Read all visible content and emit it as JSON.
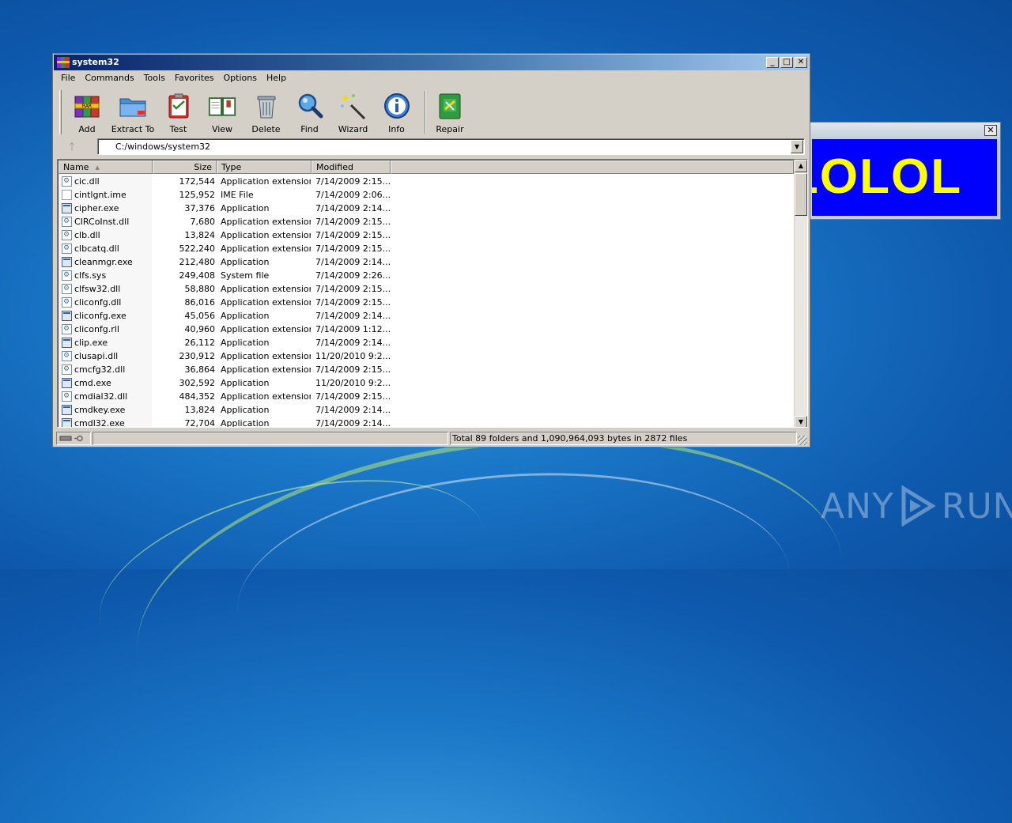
{
  "window": {
    "title": "system32"
  },
  "menu": [
    "File",
    "Commands",
    "Tools",
    "Favorites",
    "Options",
    "Help"
  ],
  "toolbar": [
    {
      "label": "Add",
      "icon": "add-archive-icon"
    },
    {
      "label": "Extract To",
      "icon": "extract-folder-icon"
    },
    {
      "label": "Test",
      "icon": "test-clipboard-icon"
    },
    {
      "label": "View",
      "icon": "view-book-icon"
    },
    {
      "label": "Delete",
      "icon": "trash-can-icon"
    },
    {
      "label": "Find",
      "icon": "magnifier-icon"
    },
    {
      "label": "Wizard",
      "icon": "magic-wand-icon"
    },
    {
      "label": "Info",
      "icon": "info-icon"
    },
    {
      "label": "Repair",
      "icon": "repair-kit-icon"
    }
  ],
  "address": {
    "path": "C:/windows/system32"
  },
  "columns": {
    "name": "Name",
    "size": "Size",
    "type": "Type",
    "modified": "Modified"
  },
  "files": [
    {
      "name": "cic.dll",
      "size": "172,544",
      "type": "Application extension",
      "modified": "7/14/2009 2:15...",
      "icon": "dll"
    },
    {
      "name": "cintlgnt.ime",
      "size": "125,952",
      "type": "IME File",
      "modified": "7/14/2009 2:06...",
      "icon": "file"
    },
    {
      "name": "cipher.exe",
      "size": "37,376",
      "type": "Application",
      "modified": "7/14/2009 2:14...",
      "icon": "exe"
    },
    {
      "name": "CIRCoInst.dll",
      "size": "7,680",
      "type": "Application extension",
      "modified": "7/14/2009 2:15...",
      "icon": "dll"
    },
    {
      "name": "clb.dll",
      "size": "13,824",
      "type": "Application extension",
      "modified": "7/14/2009 2:15...",
      "icon": "dll"
    },
    {
      "name": "clbcatq.dll",
      "size": "522,240",
      "type": "Application extension",
      "modified": "7/14/2009 2:15...",
      "icon": "dll"
    },
    {
      "name": "cleanmgr.exe",
      "size": "212,480",
      "type": "Application",
      "modified": "7/14/2009 2:14...",
      "icon": "exe"
    },
    {
      "name": "clfs.sys",
      "size": "249,408",
      "type": "System file",
      "modified": "7/14/2009 2:26...",
      "icon": "dll"
    },
    {
      "name": "clfsw32.dll",
      "size": "58,880",
      "type": "Application extension",
      "modified": "7/14/2009 2:15...",
      "icon": "dll"
    },
    {
      "name": "cliconfg.dll",
      "size": "86,016",
      "type": "Application extension",
      "modified": "7/14/2009 2:15...",
      "icon": "dll"
    },
    {
      "name": "cliconfg.exe",
      "size": "45,056",
      "type": "Application",
      "modified": "7/14/2009 2:14...",
      "icon": "exe"
    },
    {
      "name": "cliconfg.rll",
      "size": "40,960",
      "type": "Application extension",
      "modified": "7/14/2009 1:12...",
      "icon": "dll"
    },
    {
      "name": "clip.exe",
      "size": "26,112",
      "type": "Application",
      "modified": "7/14/2009 2:14...",
      "icon": "exe"
    },
    {
      "name": "clusapi.dll",
      "size": "230,912",
      "type": "Application extension",
      "modified": "11/20/2010 9:2...",
      "icon": "dll"
    },
    {
      "name": "cmcfg32.dll",
      "size": "36,864",
      "type": "Application extension",
      "modified": "7/14/2009 2:15...",
      "icon": "dll"
    },
    {
      "name": "cmd.exe",
      "size": "302,592",
      "type": "Application",
      "modified": "11/20/2010 9:2...",
      "icon": "exe"
    },
    {
      "name": "cmdial32.dll",
      "size": "484,352",
      "type": "Application extension",
      "modified": "7/14/2009 2:15...",
      "icon": "dll"
    },
    {
      "name": "cmdkey.exe",
      "size": "13,824",
      "type": "Application",
      "modified": "7/14/2009 2:14...",
      "icon": "exe"
    },
    {
      "name": "cmdl32.exe",
      "size": "72,704",
      "type": "Application",
      "modified": "7/14/2009 2:14...",
      "icon": "exe"
    }
  ],
  "status": {
    "summary": "Total 89 folders and 1,090,964,093 bytes in 2872 files"
  },
  "popup": {
    "text": "LOLOL",
    "bg": "#0000ff",
    "fg": "#ffff00"
  },
  "watermark": {
    "left": "ANY",
    "right": "RUN"
  }
}
